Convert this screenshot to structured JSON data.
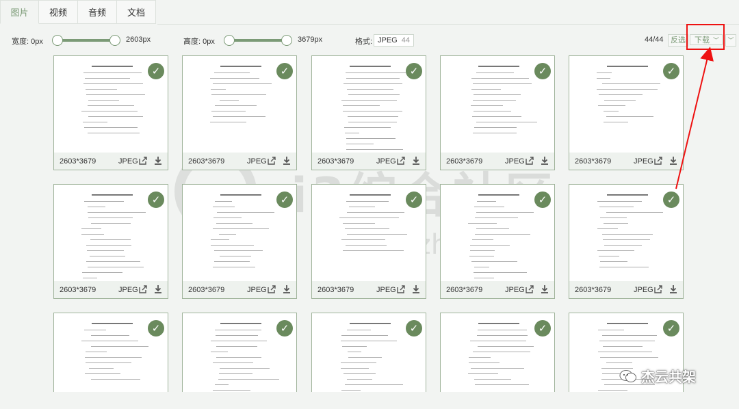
{
  "tabs": [
    {
      "label": "图片",
      "active": true
    },
    {
      "label": "视频",
      "active": false
    },
    {
      "label": "音频",
      "active": false
    },
    {
      "label": "文档",
      "active": false
    }
  ],
  "toolbar": {
    "width_label": "宽度: 0px",
    "width_max": "2603px",
    "height_label": "高度: 0px",
    "height_max": "3679px",
    "format_label": "格式:",
    "format_value": "JPEG",
    "format_count": "44",
    "count": "44/44",
    "invert_label": "反选",
    "download_label": "下载",
    "chevron_icon": "chevron-down-icon"
  },
  "colors": {
    "accent": "#7b9a76",
    "check": "#6a8a5d",
    "highlight": "#e11111"
  },
  "cards": [
    {
      "dimensions": "2603*3679",
      "format": "JPEG"
    },
    {
      "dimensions": "2603*3679",
      "format": "JPEG"
    },
    {
      "dimensions": "2603*3679",
      "format": "JPEG"
    },
    {
      "dimensions": "2603*3679",
      "format": "JPEG"
    },
    {
      "dimensions": "2603*3679",
      "format": "JPEG"
    },
    {
      "dimensions": "2603*3679",
      "format": "JPEG"
    },
    {
      "dimensions": "2603*3679",
      "format": "JPEG"
    },
    {
      "dimensions": "2603*3679",
      "format": "JPEG"
    },
    {
      "dimensions": "2603*3679",
      "format": "JPEG"
    },
    {
      "dimensions": "2603*3679",
      "format": "JPEG"
    },
    {
      "dimensions": "",
      "format": ""
    },
    {
      "dimensions": "",
      "format": ""
    },
    {
      "dimensions": "",
      "format": ""
    },
    {
      "dimensions": "",
      "format": ""
    },
    {
      "dimensions": "",
      "format": ""
    }
  ],
  "watermark": {
    "text": "i3综合社区",
    "url": "www.i3zh.com"
  },
  "wechat_label": "杰云共架"
}
